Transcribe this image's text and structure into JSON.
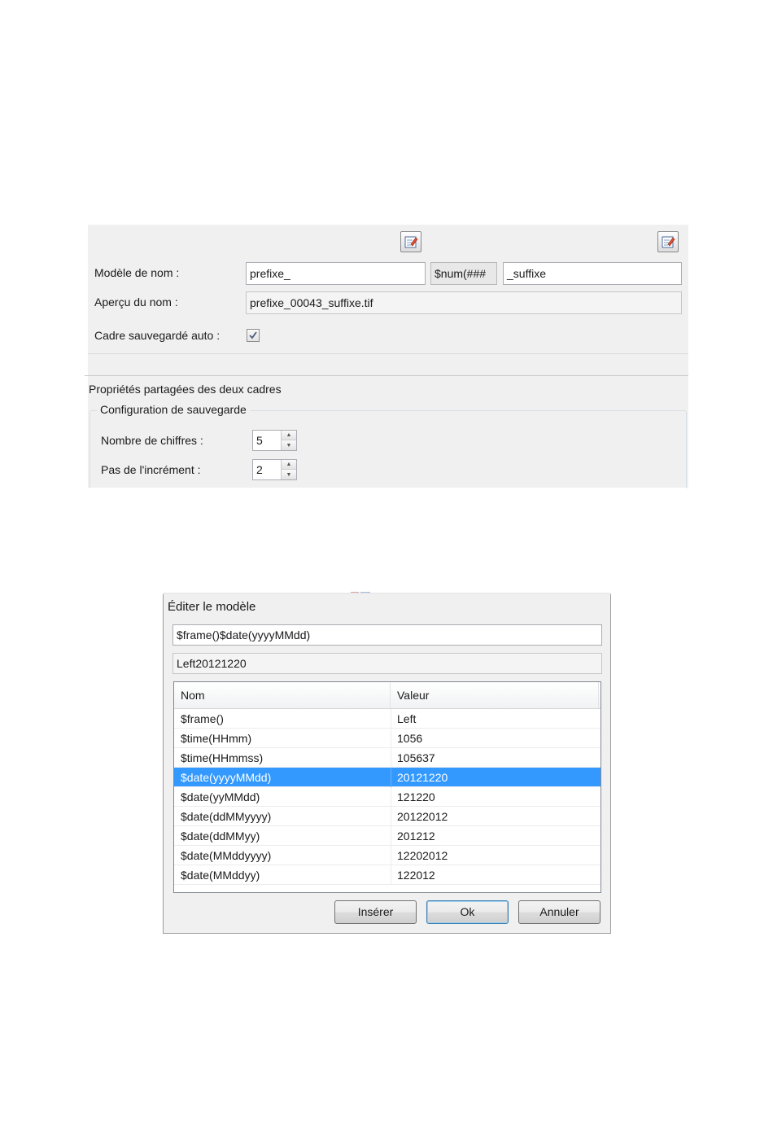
{
  "naming_panel": {
    "model_label": "Modèle de nom :",
    "prefix_value": "prefixe_",
    "num_value": "$num(###",
    "suffix_value": "_suffixe",
    "preview_label": "Aperçu du nom :",
    "preview_value": "prefixe_00043_suffixe.tif",
    "autosave_label": "Cadre sauvegardé auto :",
    "autosave_checked": true,
    "edit_icon": "edit-pencil-icon"
  },
  "shared_section": {
    "title": "Propriétés partagées des deux cadres",
    "group_title": "Configuration de sauvegarde",
    "digits_label": "Nombre de chiffres :",
    "digits_value": "5",
    "increment_label": "Pas de l'incrément :",
    "increment_value": "2"
  },
  "dialog": {
    "title": "Éditer le modèle",
    "template_value": "$frame()$date(yyyyMMdd)",
    "preview_value": "Left20121220",
    "columns": {
      "name": "Nom",
      "value": "Valeur"
    },
    "rows": [
      {
        "name": "$frame()",
        "value": "Left"
      },
      {
        "name": "$time(HHmm)",
        "value": "1056"
      },
      {
        "name": "$time(HHmmss)",
        "value": "105637"
      },
      {
        "name": "$date(yyyyMMdd)",
        "value": "20121220",
        "selected": true
      },
      {
        "name": "$date(yyMMdd)",
        "value": "121220"
      },
      {
        "name": "$date(ddMMyyyy)",
        "value": "20122012"
      },
      {
        "name": "$date(ddMMyy)",
        "value": "201212"
      },
      {
        "name": "$date(MMddyyyy)",
        "value": "12202012"
      },
      {
        "name": "$date(MMddyy)",
        "value": "122012"
      }
    ],
    "insert_label": "Insérer",
    "ok_label": "Ok",
    "cancel_label": "Annuler",
    "selection_color": "#3399ff"
  }
}
